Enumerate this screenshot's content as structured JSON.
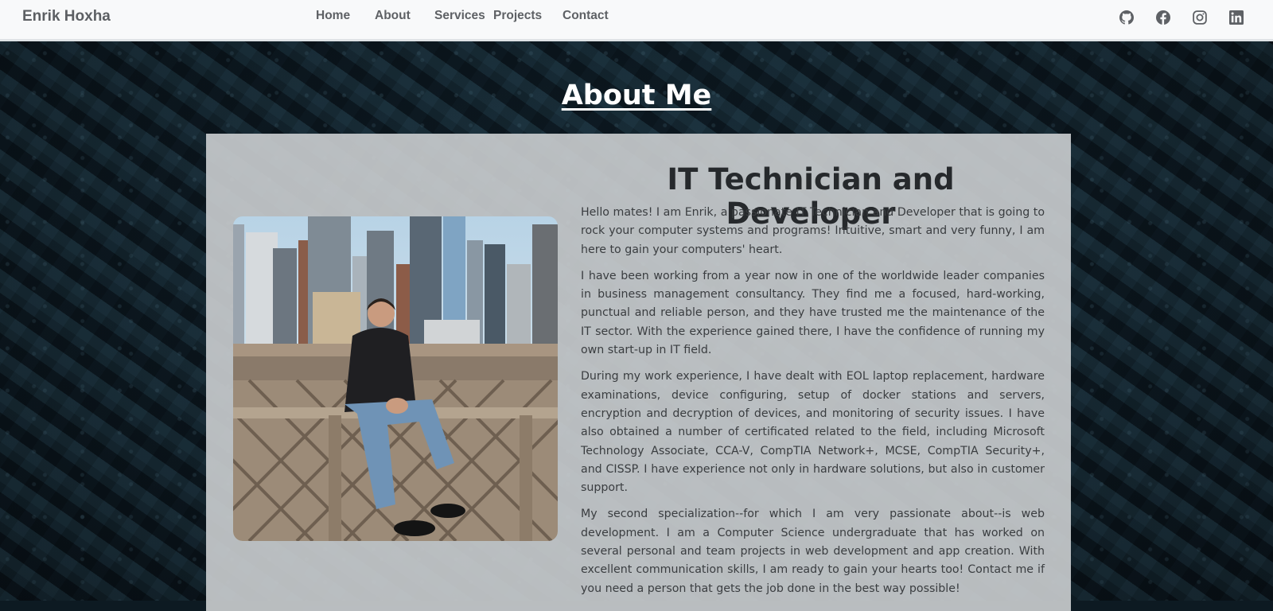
{
  "brand": "Enrik Hoxha",
  "nav": {
    "links": [
      "Home",
      "About",
      "Services",
      "Projects",
      "Contact"
    ]
  },
  "social": [
    "github-icon",
    "facebook-icon",
    "instagram-icon",
    "linkedin-icon"
  ],
  "about": {
    "title": "About Me",
    "heading": "IT Technician and Developer",
    "paragraphs": [
      "Hello mates! I am Enrik, a passionate IT Technician and Developer that is going to rock your computer systems and programs! Intuitive, smart and very funny, I am here to gain your computers' heart.",
      "I have been working from a year now in one of the worldwide leader companies in business management consultancy. They find me a focused, hard-working, punctual and reliable person, and they have trusted me the maintenance of the IT sector. With the experience gained there, I have the confidence of running my own start-up in IT field.",
      "During my work experience, I have dealt with EOL laptop replacement, hardware examinations, device configuring, setup of docker stations and servers, encryption and decryption of devices, and monitoring of security issues. I have also obtained a number of certificated related to the field, including Microsoft Technology Associate, CCA-V, CompTIA Network+, MCSE, CompTIA Security+, and CISSP. I have experience not only in hardware solutions, but also in customer support.",
      "My second specialization--for which I am very passionate about--is web development. I am a Computer Science undergraduate that has worked on several personal and team projects in web development and app creation. With excellent communication skills, I am ready to gain your hearts too! Contact me if you need a person that gets the job done in the best way possible!"
    ]
  }
}
